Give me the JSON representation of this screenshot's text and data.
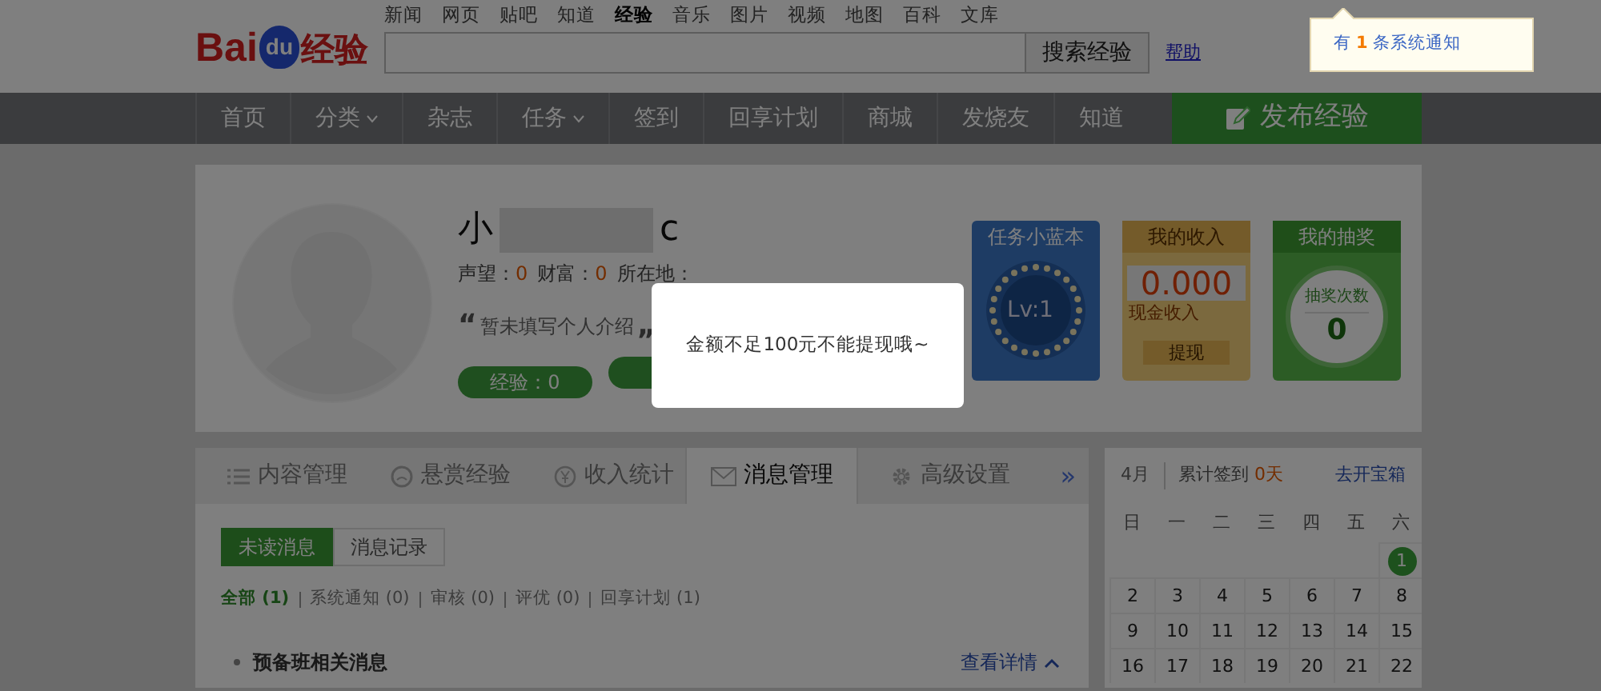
{
  "header": {
    "logo": {
      "latin": "Bai",
      "badge": "du",
      "chinese": "经验"
    },
    "top_links": [
      {
        "label": "新闻",
        "selected": false
      },
      {
        "label": "网页",
        "selected": false
      },
      {
        "label": "贴吧",
        "selected": false
      },
      {
        "label": "知道",
        "selected": false
      },
      {
        "label": "经验",
        "selected": true
      },
      {
        "label": "音乐",
        "selected": false
      },
      {
        "label": "图片",
        "selected": false
      },
      {
        "label": "视频",
        "selected": false
      },
      {
        "label": "地图",
        "selected": false
      },
      {
        "label": "百科",
        "selected": false
      },
      {
        "label": "文库",
        "selected": false
      }
    ],
    "search_button": "搜索经验",
    "help_link": "帮助"
  },
  "notification": {
    "prefix": "有",
    "count": "1",
    "suffix": "条系统通知"
  },
  "nav": {
    "items": [
      {
        "label": "首页",
        "dropdown": false
      },
      {
        "label": "分类",
        "dropdown": true
      },
      {
        "label": "杂志",
        "dropdown": false
      },
      {
        "label": "任务",
        "dropdown": true
      },
      {
        "label": "签到",
        "dropdown": false
      },
      {
        "label": "回享计划",
        "dropdown": false
      },
      {
        "label": "商城",
        "dropdown": false
      },
      {
        "label": "发烧友",
        "dropdown": false
      },
      {
        "label": "知道",
        "dropdown": false
      }
    ],
    "publish_button": "发布经验"
  },
  "profile": {
    "name_start": "小",
    "name_end": "c",
    "stats": [
      {
        "label": "声望：",
        "value": "0"
      },
      {
        "label": "财富：",
        "value": "0"
      }
    ],
    "location_label": "所在地：",
    "quote_open": "“",
    "intro": "暂未填写个人介绍",
    "quote_close": "„",
    "pills": [
      "经验：0"
    ]
  },
  "cards": [
    {
      "kind": "task",
      "title": "任务小蓝本",
      "level_text": "Lv:1"
    },
    {
      "kind": "income",
      "title": "我的收入",
      "amount": "0.000",
      "caption": "现金收入",
      "button": "提现"
    },
    {
      "kind": "lottery",
      "title": "我的抽奖",
      "caption": "抽奖次数",
      "count": "0"
    }
  ],
  "tabs": [
    {
      "label": "内容管理",
      "selected": false
    },
    {
      "label": "悬赏经验",
      "selected": false
    },
    {
      "label": "收入统计",
      "selected": false
    },
    {
      "label": "消息管理",
      "selected": true
    },
    {
      "label": "高级设置",
      "selected": false
    }
  ],
  "tabs_more": "»",
  "subtabs": [
    {
      "label": "未读消息",
      "selected": true
    },
    {
      "label": "消息记录",
      "selected": false
    }
  ],
  "filters": [
    {
      "label": "全部 (1)",
      "selected": true
    },
    {
      "label": "系统通知 (0)",
      "selected": false
    },
    {
      "label": "审核 (0)",
      "selected": false
    },
    {
      "label": "评优 (0)",
      "selected": false
    },
    {
      "label": "回享计划 (1)",
      "selected": false
    }
  ],
  "section": {
    "title": "预备班相关消息",
    "link": "查看详情"
  },
  "calendar": {
    "month": "4月",
    "total_label": "累计签到",
    "total_value": "0天",
    "chest_link": "去开宝箱",
    "weekdays": [
      "日",
      "一",
      "二",
      "三",
      "四",
      "五",
      "六"
    ],
    "weeks": [
      {
        "days": [
          {
            "day": "1",
            "signed": true
          }
        ]
      },
      {
        "days": [
          {
            "day": "2",
            "signed": false
          },
          {
            "day": "3",
            "signed": false
          },
          {
            "day": "4",
            "signed": false
          },
          {
            "day": "5",
            "signed": false
          },
          {
            "day": "6",
            "signed": false
          },
          {
            "day": "7",
            "signed": false
          },
          {
            "day": "8",
            "signed": false
          }
        ]
      },
      {
        "days": [
          {
            "day": "9",
            "signed": false
          },
          {
            "day": "10",
            "signed": false
          },
          {
            "day": "11",
            "signed": false
          },
          {
            "day": "12",
            "signed": false
          },
          {
            "day": "13",
            "signed": false
          },
          {
            "day": "14",
            "signed": false
          },
          {
            "day": "15",
            "signed": false
          }
        ]
      },
      {
        "days": [
          {
            "day": "16",
            "signed": false
          },
          {
            "day": "17",
            "signed": false
          },
          {
            "day": "18",
            "signed": false
          },
          {
            "day": "19",
            "signed": false
          },
          {
            "day": "20",
            "signed": false
          },
          {
            "day": "21",
            "signed": false
          },
          {
            "day": "22",
            "signed": false
          }
        ]
      }
    ]
  },
  "modal": {
    "message": "金额不足100元不能提现哦~"
  }
}
